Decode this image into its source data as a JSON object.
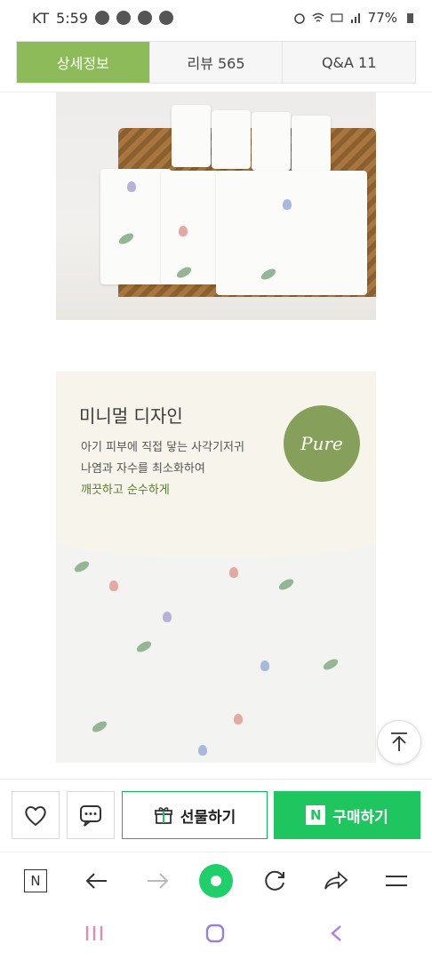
{
  "status_bar": {
    "carrier": "KT",
    "time": "5:59",
    "battery": "77%",
    "left_icons": [
      "talk-icon",
      "timer-icon",
      "cloud-icon",
      "cloud-icon"
    ],
    "right_icons": [
      "alarm-icon",
      "wifi-icon",
      "hd-icon",
      "signal-icon",
      "battery-icon"
    ]
  },
  "tabs": [
    {
      "label": "상세정보",
      "active": true
    },
    {
      "label": "리뷰  565",
      "active": false
    },
    {
      "label": "Q&A  11",
      "active": false
    }
  ],
  "promo": {
    "title": "미니멀 디자인",
    "lines": [
      "아기 피부에 직접 닿는 사각기저귀",
      "나염과 자수를 최소화하여",
      "깨끗하고 순수하게"
    ],
    "badge": "Pure"
  },
  "actions": {
    "gift_label": "선물하기",
    "buy_label": "구매하기",
    "n_mark": "N"
  },
  "browser_nav": {
    "items": [
      "n-tab-icon",
      "back-icon",
      "forward-icon",
      "home-icon",
      "refresh-icon",
      "share-icon",
      "menu-icon"
    ],
    "n_mark": "N"
  },
  "colors": {
    "tab_active": "#8dbb5a",
    "buy_green": "#1fc660",
    "badge_green": "#86a05b"
  }
}
